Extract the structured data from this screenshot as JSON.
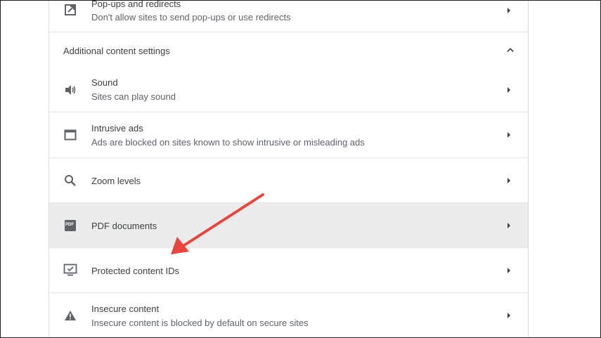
{
  "colors": {
    "text_primary": "#3c4043",
    "text_secondary": "#5f6368",
    "row_highlight": "#ececec",
    "arrow": "#e8453c"
  },
  "rows": {
    "popups": {
      "icon": "external-link-icon",
      "title": "Pop-ups and redirects",
      "desc": "Don't allow sites to send pop-ups or use redirects"
    },
    "section": {
      "title": "Additional content settings",
      "icon": "chevron-up-icon"
    },
    "sound": {
      "icon": "speaker-icon",
      "title": "Sound",
      "desc": "Sites can play sound"
    },
    "intrusive_ads": {
      "icon": "browser-window-icon",
      "title": "Intrusive ads",
      "desc": "Ads are blocked on sites known to show intrusive or misleading ads"
    },
    "zoom": {
      "icon": "magnifier-icon",
      "title": "Zoom levels"
    },
    "pdf": {
      "icon": "pdf-icon",
      "icon_text": "PDF",
      "title": "PDF documents"
    },
    "protected": {
      "icon": "monitor-check-icon",
      "title": "Protected content IDs"
    },
    "insecure": {
      "icon": "warning-triangle-icon",
      "title": "Insecure content",
      "desc": "Insecure content is blocked by default on secure sites"
    }
  },
  "annotation": {
    "icon": "red-arrow-annotation"
  }
}
